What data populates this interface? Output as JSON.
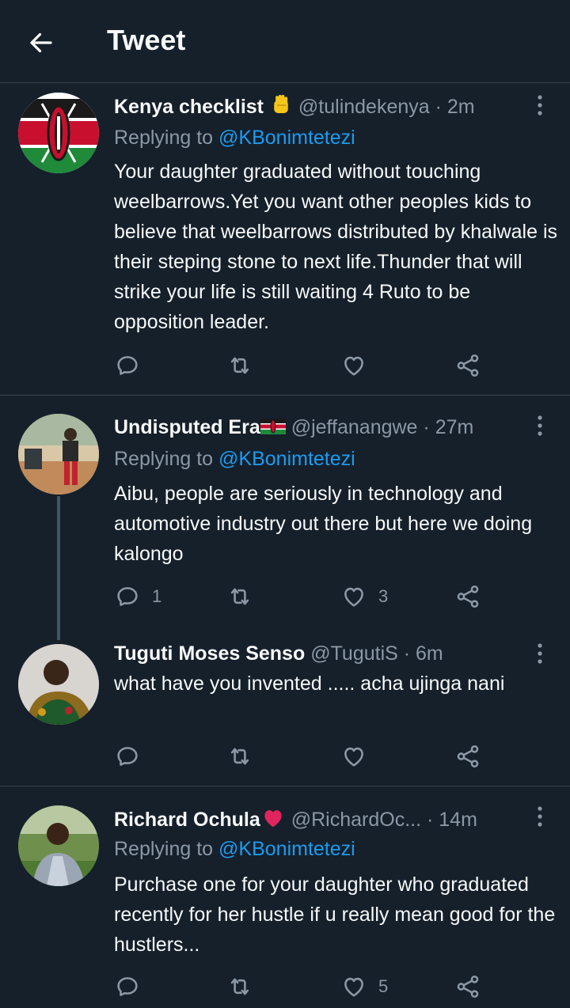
{
  "header": {
    "title": "Tweet"
  },
  "tweets": [
    {
      "name": "Kenya checklist",
      "handle": "@tulindekenya",
      "time": "· 2m",
      "replying_prefix": "Replying to ",
      "replying_to": "@KBonimtetezi",
      "text": "Your daughter graduated without touching weelbarrows.Yet you want other peoples kids to believe that weelbarrows distributed by khalwale is their steping stone to  next life.Thunder that will strike your life is still waiting 4 Ruto to be opposition leader.",
      "replies": "",
      "likes": ""
    },
    {
      "name": "Undisputed Era",
      "handle": "@jeffanangwe",
      "time": "· 27m",
      "replying_prefix": "Replying to ",
      "replying_to": "@KBonimtetezi",
      "text": "Aibu, people are seriously in technology and automotive industry out there but here we doing kalongo",
      "replies": "1",
      "likes": "3"
    },
    {
      "name": "Tuguti Moses Senso",
      "handle": "@TugutiS",
      "time": "· 6m",
      "text": "what have you invented ..... acha ujinga nani",
      "replies": "",
      "likes": ""
    },
    {
      "name": "Richard Ochula",
      "handle": "@RichardOc...",
      "time": "· 14m",
      "replying_prefix": "Replying to ",
      "replying_to": "@KBonimtetezi",
      "text": "Purchase one for your daughter who graduated recently for her hustle if u really mean good for the hustlers...",
      "replies": "",
      "likes": "5"
    }
  ],
  "colors": {
    "background": "#15202b",
    "link": "#1d9bf0",
    "muted": "#8b98a5",
    "divider": "#38444d"
  },
  "icons": [
    "back-arrow-icon",
    "more-icon",
    "reply-icon",
    "retweet-icon",
    "like-icon",
    "share-icon",
    "raised-fist-emoji",
    "kenya-flag-emoji",
    "heart-emoji"
  ]
}
